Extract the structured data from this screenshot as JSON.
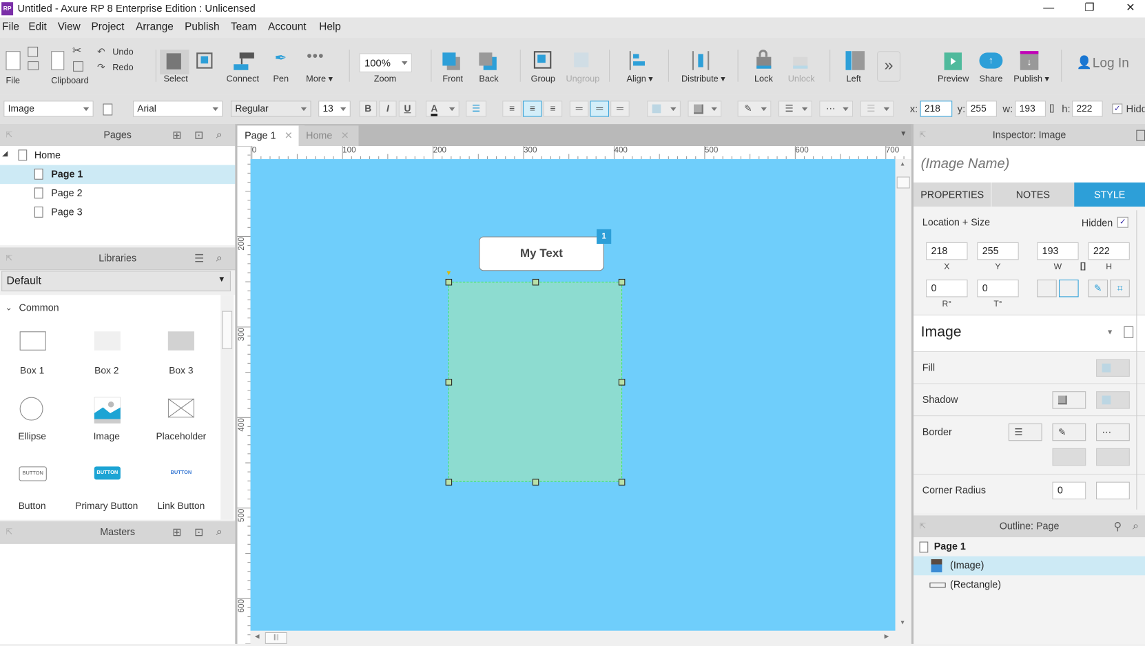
{
  "window": {
    "title": "Untitled - Axure RP 8 Enterprise Edition : Unlicensed",
    "logo": "RP",
    "controls": {
      "minimize": "—",
      "restore": "❐",
      "close": "✕"
    }
  },
  "menu": [
    "File",
    "Edit",
    "View",
    "Project",
    "Arrange",
    "Publish",
    "Team",
    "Account",
    "Help"
  ],
  "toolbar": {
    "file_label": "File",
    "clipboard_label": "Clipboard",
    "undo": "Undo",
    "redo": "Redo",
    "select": "Select",
    "connect": "Connect",
    "pen": "Pen",
    "more": "More ▾",
    "zoom_value": "100%",
    "zoom_label": "Zoom",
    "front": "Front",
    "back": "Back",
    "group": "Group",
    "ungroup": "Ungroup",
    "align": "Align ▾",
    "distribute": "Distribute ▾",
    "lock": "Lock",
    "unlock": "Unlock",
    "left": "Left",
    "overflow": "»",
    "preview": "Preview",
    "share": "Share",
    "publish": "Publish ▾",
    "login": "Log In"
  },
  "formatbar": {
    "style_value": "Image",
    "font_value": "Arial",
    "weight_value": "Regular",
    "size_value": "13",
    "bold": "B",
    "italic": "I",
    "underline": "U",
    "font_color": "A",
    "x_label": "x:",
    "x_value": "218",
    "y_label": "y:",
    "y_value": "255",
    "w_label": "w:",
    "w_value": "193",
    "h_label": "h:",
    "h_value": "222",
    "hidden_label": "Hidd",
    "hidden_checked": true
  },
  "pages_panel": {
    "title": "Pages",
    "tree": [
      {
        "label": "Home",
        "level": 0,
        "expanded": true,
        "selected": false
      },
      {
        "label": "Page 1",
        "level": 1,
        "selected": true
      },
      {
        "label": "Page 2",
        "level": 1,
        "selected": false
      },
      {
        "label": "Page 3",
        "level": 1,
        "selected": false
      }
    ]
  },
  "libraries_panel": {
    "title": "Libraries",
    "library_value": "Default",
    "section": "Common",
    "widgets": [
      "Box 1",
      "Box 2",
      "Box 3",
      "Ellipse",
      "Image",
      "Placeholder",
      "Button",
      "Primary Button",
      "Link Button"
    ],
    "button_glyph": "BUTTON"
  },
  "masters_panel": {
    "title": "Masters"
  },
  "canvas": {
    "tabs": [
      {
        "label": "Page 1",
        "active": true
      },
      {
        "label": "Home",
        "active": false
      }
    ],
    "hruler_ticks": [
      "0",
      "100",
      "200",
      "300",
      "400",
      "500",
      "600",
      "700"
    ],
    "vruler_ticks": [
      "200",
      "300",
      "400",
      "500",
      "600"
    ],
    "background_color": "#6fcefb",
    "text_widget": "My Text",
    "note_badge": "1",
    "image_fill": "#8ddcd0"
  },
  "inspector": {
    "title": "Inspector: Image",
    "name_placeholder": "(Image Name)",
    "tabs": [
      {
        "label": "PROPERTIES",
        "active": false
      },
      {
        "label": "NOTES",
        "active": false
      },
      {
        "label": "STYLE",
        "active": true
      }
    ],
    "location_size_label": "Location + Size",
    "hidden_label": "Hidden",
    "hidden_checked": true,
    "x": "218",
    "x_caption": "X",
    "y": "255",
    "y_caption": "Y",
    "w": "193",
    "w_caption": "W",
    "h": "222",
    "h_caption": "H",
    "rotation": "0",
    "rotation_caption": "R°",
    "text_rotation": "0",
    "text_rotation_caption": "T°",
    "style_name": "Image",
    "fill_label": "Fill",
    "shadow_label": "Shadow",
    "border_label": "Border",
    "corner_radius_label": "Corner Radius",
    "corner_radius_value": "0",
    "accent_color": "#2d9fd8"
  },
  "outline_panel": {
    "title": "Outline: Page",
    "items": [
      {
        "label": "Page 1",
        "type": "page",
        "selected": false
      },
      {
        "label": "(Image)",
        "type": "image",
        "selected": true
      },
      {
        "label": "(Rectangle)",
        "type": "rectangle",
        "selected": false
      }
    ]
  }
}
